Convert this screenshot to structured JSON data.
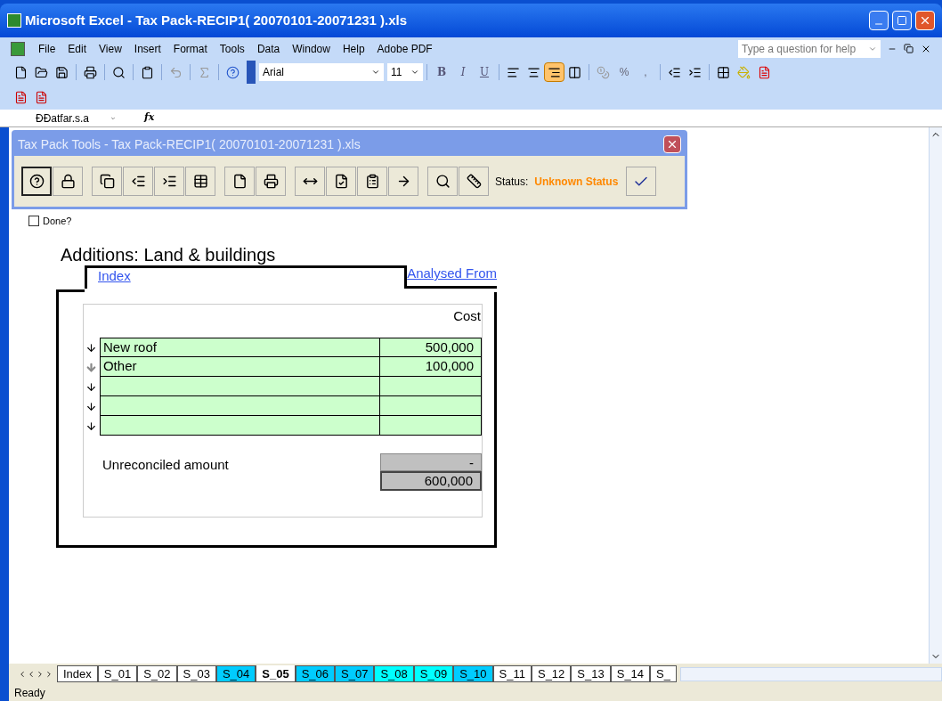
{
  "window": {
    "title": "Microsoft Excel - Tax Pack-RECIP1( 20070101-20071231 ).xls"
  },
  "menu": [
    "File",
    "Edit",
    "View",
    "Insert",
    "Format",
    "Tools",
    "Data",
    "Window",
    "Help",
    "Adobe PDF"
  ],
  "help_box": {
    "placeholder": "Type a question for help"
  },
  "font_box": {
    "value": "Arial"
  },
  "size_box": {
    "value": "11"
  },
  "bold_glyphs": [
    "B",
    "I",
    "U"
  ],
  "alignment": [
    {
      "selected": false
    },
    {
      "selected": false
    },
    {
      "selected": true
    },
    {
      "selected": false
    }
  ],
  "number_glyphs": [
    "%",
    ","
  ],
  "name_box": {
    "value": "ÐÐatfar.s.a"
  },
  "fx": "fx",
  "tool_window": {
    "title": "Tax Pack Tools - Tax Pack-RECIP1( 20070101-20071231 ).xls",
    "status_label": "Status:",
    "status_value": "Unknown Status"
  },
  "done": {
    "label": "Done?",
    "checked": false
  },
  "sheet": {
    "heading": "Additions: Land & buildings",
    "link_left": "Index",
    "link_right": "Analysed From",
    "column": "Cost",
    "rows": [
      {
        "kind": "hollow",
        "description": "New roof",
        "cost": "500,000"
      },
      {
        "kind": "filled",
        "description": "Other",
        "cost": "100,000"
      },
      {
        "kind": "hollow",
        "description": "",
        "cost": ""
      },
      {
        "kind": "hollow",
        "description": "",
        "cost": ""
      },
      {
        "kind": "hollow",
        "description": "",
        "cost": ""
      }
    ],
    "unreconciled_label": "Unreconciled amount",
    "unreconciled_value": "-",
    "total": "600,000"
  },
  "sheet_tabs": [
    {
      "label": "Index",
      "selected": false,
      "color": "#ffffff"
    },
    {
      "label": "S_01",
      "selected": false,
      "color": "#ffffff"
    },
    {
      "label": "S_02",
      "selected": false,
      "color": "#ffffff"
    },
    {
      "label": "S_03",
      "selected": false,
      "color": "#ffffff"
    },
    {
      "label": "S_04",
      "selected": false,
      "color": "#00ccff"
    },
    {
      "label": "S_05",
      "selected": true,
      "color": "#ffffff"
    },
    {
      "label": "S_06",
      "selected": false,
      "color": "#00ccff"
    },
    {
      "label": "S_07",
      "selected": false,
      "color": "#00ccff"
    },
    {
      "label": "S_08",
      "selected": false,
      "color": "#00ffff"
    },
    {
      "label": "S_09",
      "selected": false,
      "color": "#00ffff"
    },
    {
      "label": "S_10",
      "selected": false,
      "color": "#00ccff"
    },
    {
      "label": "S_11",
      "selected": false,
      "color": "#ffffff"
    },
    {
      "label": "S_12",
      "selected": false,
      "color": "#ffffff"
    },
    {
      "label": "S_13",
      "selected": false,
      "color": "#ffffff"
    },
    {
      "label": "S_14",
      "selected": false,
      "color": "#ffffff"
    },
    {
      "label": "S_",
      "selected": false,
      "color": "#ffffff"
    }
  ],
  "status_bar": {
    "text": "Ready"
  }
}
